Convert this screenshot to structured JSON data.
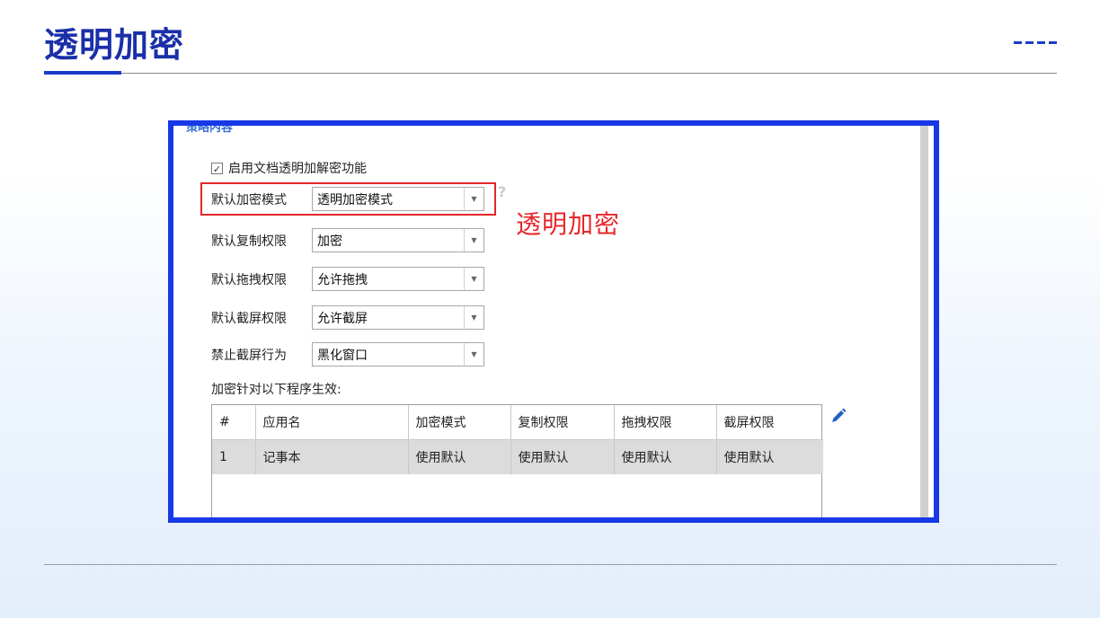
{
  "slide": {
    "title": "透明加密"
  },
  "screenshot": {
    "section_heading": "策略内容",
    "enable_checkbox": {
      "checked": true,
      "label": "启用文档透明加解密功能"
    },
    "fields": [
      {
        "label": "默认加密模式",
        "value": "透明加密模式"
      },
      {
        "label": "默认复制权限",
        "value": "加密"
      },
      {
        "label": "默认拖拽权限",
        "value": "允许拖拽"
      },
      {
        "label": "默认截屏权限",
        "value": "允许截屏"
      },
      {
        "label": "禁止截屏行为",
        "value": "黑化窗口"
      }
    ],
    "annotation": "透明加密",
    "help_icon_glyph": "?",
    "table_caption": "加密针对以下程序生效:",
    "table": {
      "columns": [
        "#",
        "应用名",
        "加密模式",
        "复制权限",
        "拖拽权限",
        "截屏权限"
      ],
      "rows": [
        [
          "1",
          "记事本",
          "使用默认",
          "使用默认",
          "使用默认",
          "使用默认"
        ]
      ]
    }
  },
  "colors": {
    "title": "#1a2fa8",
    "accent": "#1a3cc8",
    "frame": "#1738e6",
    "highlight": "#e3262a",
    "edit_icon": "#1f5fc0"
  }
}
